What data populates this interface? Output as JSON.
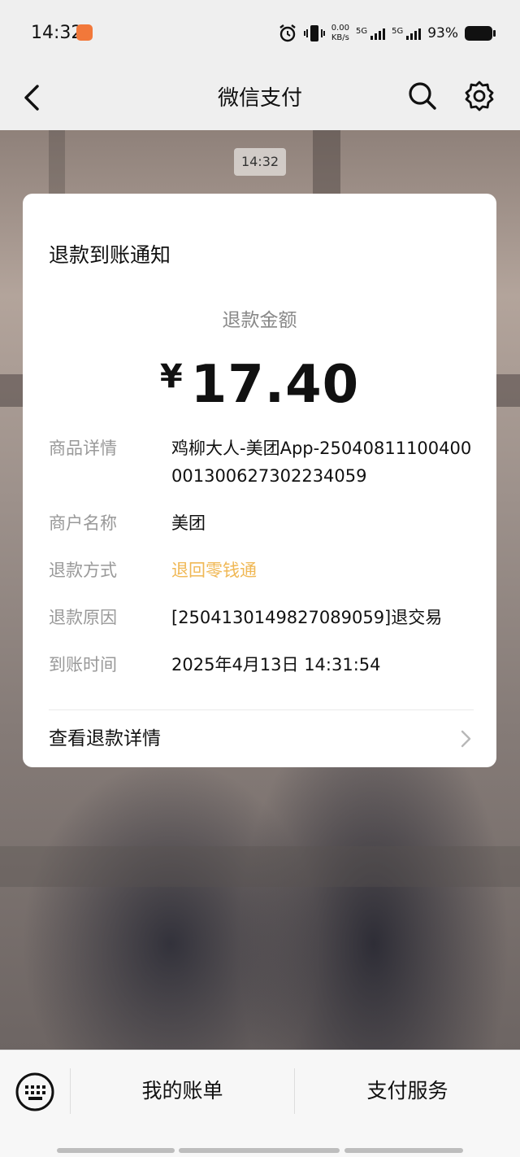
{
  "status_bar": {
    "time": "14:32",
    "net_speed_value": "0.00",
    "net_speed_unit": "KB/s",
    "sim1": "5G",
    "sim2": "5G",
    "battery": "93%"
  },
  "nav": {
    "title": "微信支付"
  },
  "chat": {
    "timestamp": "14:32"
  },
  "card": {
    "title": "退款到账通知",
    "amount_label": "退款金额",
    "currency": "¥",
    "amount": "17.40",
    "rows": [
      {
        "label": "商品详情",
        "value": "鸡柳大人-美团App-25040811100400001300627302234059"
      },
      {
        "label": "商户名称",
        "value": "美团"
      },
      {
        "label": "退款方式",
        "value": "退回零钱通"
      },
      {
        "label": "退款原因",
        "value": "[2504130149827089059]退交易"
      },
      {
        "label": "到账时间",
        "value": "2025年4月13日 14:31:54"
      }
    ],
    "details_link": "查看退款详情",
    "accent_color": "#f0b855"
  },
  "bottom_bar": {
    "menu_items": [
      {
        "label": "我的账单"
      },
      {
        "label": "支付服务"
      }
    ]
  },
  "icons": [
    "alarm-icon",
    "vibrate-icon",
    "signal-icon",
    "battery-icon",
    "back-icon",
    "search-icon",
    "gear-icon",
    "chevron-right-icon",
    "keyboard-icon"
  ]
}
